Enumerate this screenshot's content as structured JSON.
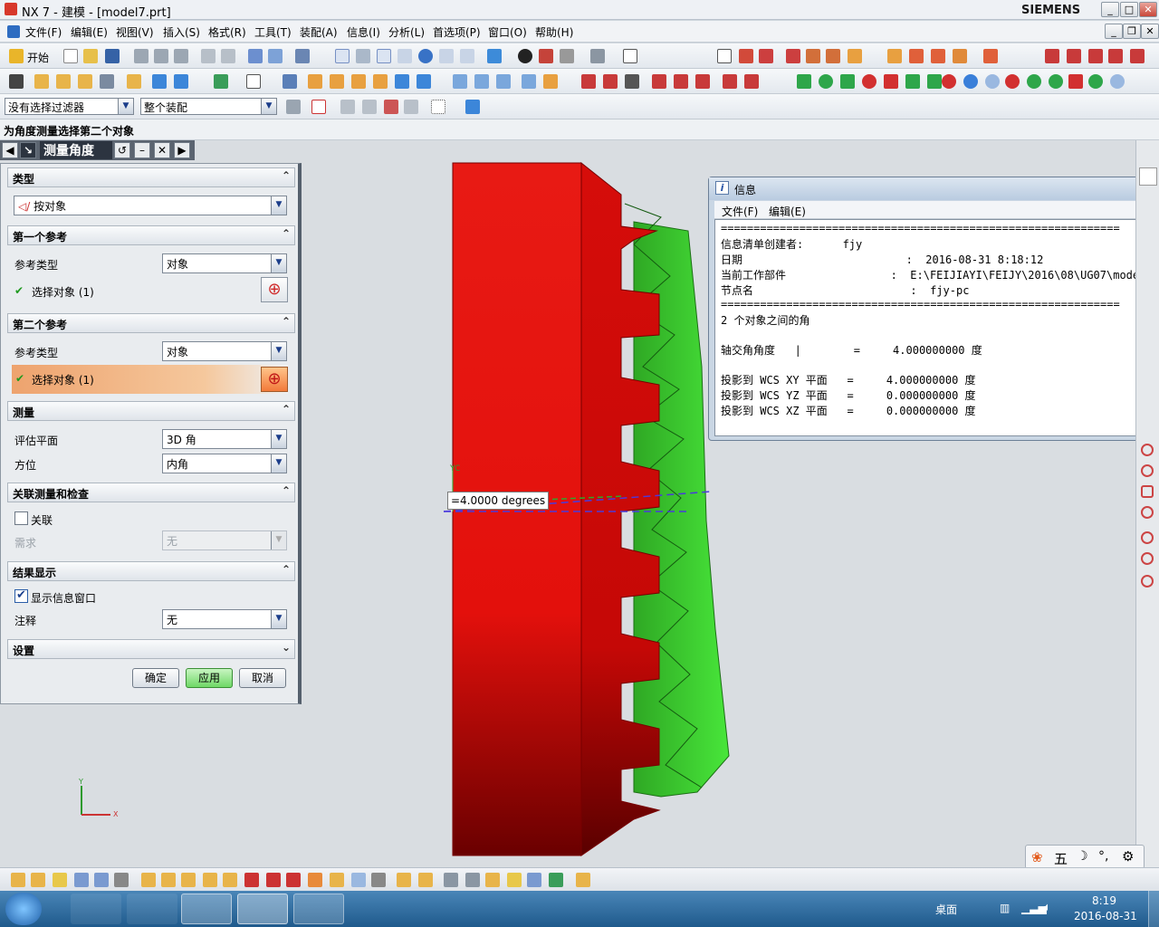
{
  "window": {
    "title": "NX 7 - 建模 - [model7.prt]",
    "brand": "SIEMENS"
  },
  "menu": [
    "文件(F)",
    "编辑(E)",
    "视图(V)",
    "插入(S)",
    "格式(R)",
    "工具(T)",
    "装配(A)",
    "信息(I)",
    "分析(L)",
    "首选项(P)",
    "窗口(O)",
    "帮助(H)"
  ],
  "toolbar": {
    "start_label": "开始",
    "filter_value": "没有选择过滤器",
    "assembly_value": "整个装配"
  },
  "cue_line": "为角度测量选择第二个对象",
  "dialog": {
    "title": "测量角度",
    "type_section": "类型",
    "type_value": "按对象",
    "ref1_section": "第一个参考",
    "ref1_type_label": "参考类型",
    "ref1_type_value": "对象",
    "ref1_select": "选择对象 (1)",
    "ref2_section": "第二个参考",
    "ref2_type_label": "参考类型",
    "ref2_type_value": "对象",
    "ref2_select": "选择对象 (1)",
    "measure_section": "测量",
    "eval_plane_label": "评估平面",
    "eval_plane_value": "3D 角",
    "orient_label": "方位",
    "orient_value": "内角",
    "assoc_section": "关联测量和检查",
    "assoc_label": "关联",
    "req_label": "需求",
    "req_value": "无",
    "result_section": "结果显示",
    "show_info_label": "显示信息窗口",
    "annotation_label": "注释",
    "annotation_value": "无",
    "settings_section": "设置",
    "ok": "确定",
    "apply": "应用",
    "cancel": "取消"
  },
  "measure_label": "=4.0000 degrees",
  "axis_label_yc": "YC",
  "triad": {
    "x": "X",
    "y": "Y"
  },
  "info": {
    "title": "信息",
    "menu_file": "文件(F)",
    "menu_edit": "编辑(E)",
    "lines": [
      "=============================================================",
      "信息清单创建者:      fjy",
      "日期                         :  2016-08-31 8:18:12",
      "当前工作部件                :  E:\\FEIJIAYI\\FEIJY\\2016\\08\\UG07\\model7.prt",
      "节点名                        :  fjy-pc",
      "=============================================================",
      "2 个对象之间的角",
      "",
      "轴交角角度   |        =     4.000000000 度",
      "",
      "投影到 WCS XY 平面   =     4.000000000 度",
      "投影到 WCS YZ 平面   =     0.000000000 度",
      "投影到 WCS XZ 平面   =     0.000000000 度"
    ]
  },
  "taskbar": {
    "desktop": "桌面",
    "time": "8:19",
    "date": "2016-08-31"
  },
  "ime": {
    "wu": "五"
  },
  "colors": {
    "gear_red": "#e0120f",
    "gear_green": "#3ddc2e",
    "apply_btn": "#8fe08a",
    "highlight_row": "#f0b080"
  }
}
